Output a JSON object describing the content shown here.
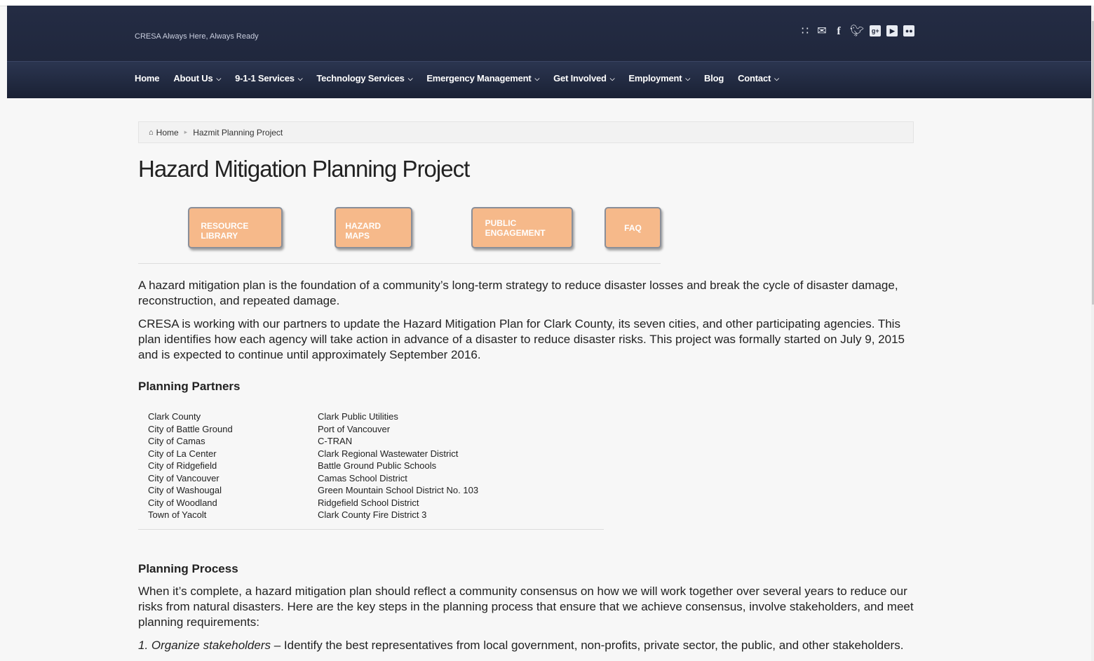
{
  "header": {
    "tagline": "CRESA Always Here, Always Ready",
    "social_icons": [
      "rss-icon",
      "email-icon",
      "facebook-icon",
      "twitter-icon",
      "google-plus-icon",
      "youtube-icon",
      "flickr-icon"
    ]
  },
  "nav": {
    "items": [
      {
        "label": "Home",
        "has_dropdown": false
      },
      {
        "label": "About Us",
        "has_dropdown": true
      },
      {
        "label": "9-1-1 Services",
        "has_dropdown": true
      },
      {
        "label": "Technology Services",
        "has_dropdown": true
      },
      {
        "label": "Emergency Management",
        "has_dropdown": true
      },
      {
        "label": "Get Involved",
        "has_dropdown": true
      },
      {
        "label": "Employment",
        "has_dropdown": true
      },
      {
        "label": "Blog",
        "has_dropdown": false
      },
      {
        "label": "Contact",
        "has_dropdown": true
      }
    ]
  },
  "breadcrumb": {
    "home": "Home",
    "current": "Hazmit Planning Project"
  },
  "page": {
    "title": "Hazard Mitigation Planning Project",
    "buttons": [
      {
        "label": "RESOURCE LIBRARY"
      },
      {
        "label": "HAZARD MAPS"
      },
      {
        "label": "PUBLIC ENGAGEMENT"
      },
      {
        "label": "FAQ"
      }
    ],
    "intro_1": "A hazard mitigation plan is the foundation of a community’s long-term strategy to reduce disaster losses and break the cycle of disaster damage, reconstruction, and repeated damage.",
    "intro_2": "CRESA is working with our partners to update the Hazard Mitigation Plan for Clark County, its seven cities, and other participating agencies. This plan identifies how each agency will take action in advance of a disaster to reduce disaster risks. This project was formally started on July 9, 2015 and is expected to continue until approximately September 2016.",
    "partners_heading": "Planning Partners",
    "partners_left": [
      "Clark County",
      "City of Battle Ground",
      "City of Camas",
      "City of La Center",
      "City of Ridgefield",
      "City of Vancouver",
      "City of Washougal",
      "City of Woodland",
      "Town of Yacolt"
    ],
    "partners_right": [
      "Clark Public Utilities",
      "Port of Vancouver",
      "C-TRAN",
      "Clark Regional Wastewater District",
      "Battle Ground Public Schools",
      "Camas School District",
      "Green Mountain School District No. 103",
      "Ridgefield School District",
      "Clark County Fire District 3"
    ],
    "process_heading": "Planning Process",
    "process_text": "When it’s complete, a hazard mitigation plan should reflect a community consensus on how we will work together over several years to reduce our risks from natural disasters.   Here are the key steps in the planning process that ensure that we achieve consensus, involve stakeholders, and meet planning requirements:",
    "step1_title": "1. Organize stakeholders",
    "step1_text": " – Identify the best representatives from local government, non-profits,  private sector, the public, and other stakeholders."
  },
  "colors": {
    "header_bg": "#1d2438",
    "button_bg": "#f6b98a",
    "page_bg": "#f7f7f7"
  }
}
